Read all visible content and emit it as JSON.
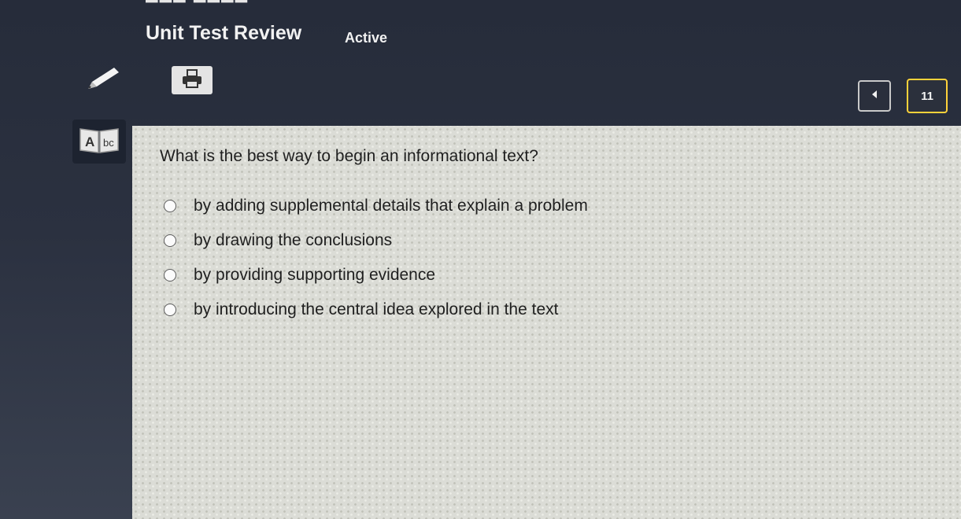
{
  "header": {
    "title": "Unit Test Review",
    "status": "Active"
  },
  "toolbar": {
    "pencil_icon": "pencil-icon",
    "print_icon": "printer-icon",
    "reader_icon": "text-reader-icon",
    "reader_letters": {
      "upper": "A",
      "lower": "bc"
    }
  },
  "pagination": {
    "prev_icon": "caret-left-icon",
    "current_page": "11"
  },
  "question": {
    "text": "What is the best way to begin an informational text?",
    "choices": [
      "by adding supplemental details that explain a problem",
      "by drawing the conclusions",
      "by providing supporting evidence",
      "by introducing the central idea explored in the text"
    ]
  },
  "colors": {
    "background": "#2b3140",
    "panel": "#dbdcd6",
    "accent_border": "#ffd23a",
    "text_dark": "#1f1f1f",
    "text_light": "#f2f2f2"
  }
}
